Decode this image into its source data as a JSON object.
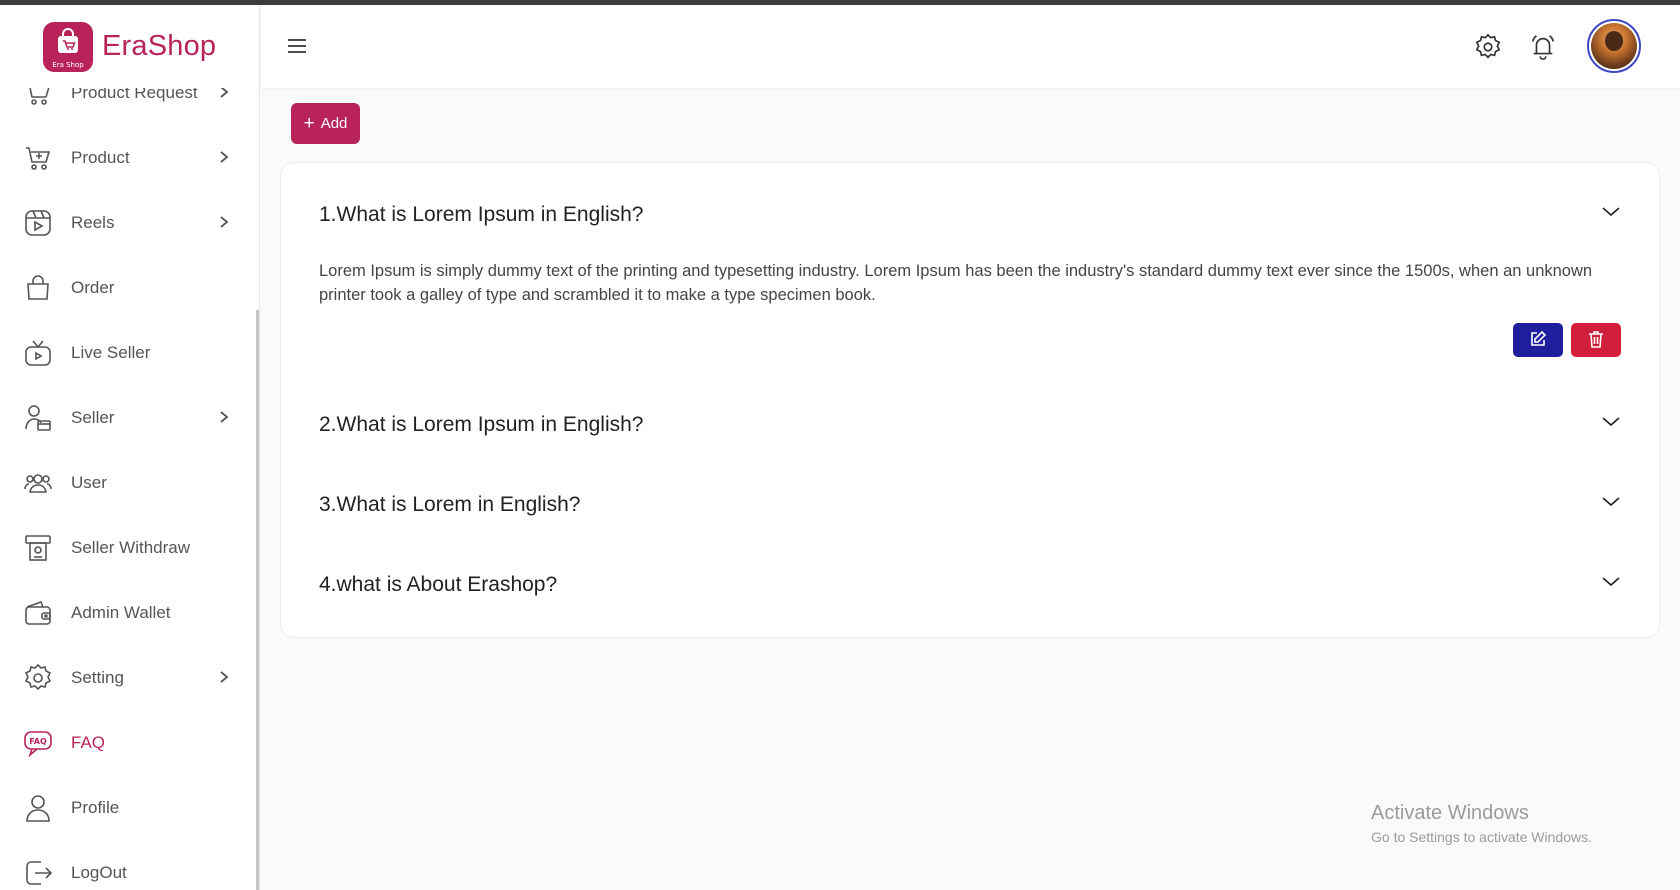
{
  "brand": {
    "name": "EraShop",
    "logo_text": "Era Shop",
    "accent_color": "#b8235a"
  },
  "sidebar": {
    "items": [
      {
        "label": "Product Request",
        "icon": "cart-icon",
        "chevron": true,
        "active": false
      },
      {
        "label": "Product",
        "icon": "cart-add-icon",
        "chevron": true,
        "active": false
      },
      {
        "label": "Reels",
        "icon": "reels-icon",
        "chevron": true,
        "active": false
      },
      {
        "label": "Order",
        "icon": "bag-icon",
        "chevron": false,
        "active": false
      },
      {
        "label": "Live Seller",
        "icon": "live-tv-icon",
        "chevron": false,
        "active": false
      },
      {
        "label": "Seller",
        "icon": "seller-icon",
        "chevron": true,
        "active": false
      },
      {
        "label": "User",
        "icon": "users-icon",
        "chevron": false,
        "active": false
      },
      {
        "label": "Seller Withdraw",
        "icon": "withdraw-icon",
        "chevron": false,
        "active": false
      },
      {
        "label": "Admin Wallet",
        "icon": "wallet-icon",
        "chevron": false,
        "active": false
      },
      {
        "label": "Setting",
        "icon": "gear-icon",
        "chevron": true,
        "active": false
      },
      {
        "label": "FAQ",
        "icon": "faq-icon",
        "chevron": false,
        "active": true
      },
      {
        "label": "Profile",
        "icon": "profile-icon",
        "chevron": false,
        "active": false
      },
      {
        "label": "LogOut",
        "icon": "logout-icon",
        "chevron": false,
        "active": false
      }
    ]
  },
  "header": {
    "menu_icon": "hamburger-icon",
    "settings_icon": "gear-icon",
    "notification_icon": "bell-icon",
    "avatar_icon": "avatar"
  },
  "main": {
    "add_label": "Add",
    "faqs": [
      {
        "question": "1.What is Lorem Ipsum in English?",
        "answer": "Lorem Ipsum is simply dummy text of the printing and typesetting industry. Lorem Ipsum has been the industry's standard dummy text ever since the 1500s, when an unknown printer took a galley of type and scrambled it to make a type specimen book.",
        "expanded": true
      },
      {
        "question": "2.What is Lorem Ipsum in English?",
        "expanded": false
      },
      {
        "question": "3.What is Lorem in English?",
        "expanded": false
      },
      {
        "question": "4.what is About Erashop?",
        "expanded": false
      }
    ],
    "edit_color": "#1f1f9e",
    "delete_color": "#cf1f3a"
  },
  "watermark": {
    "title": "Activate Windows",
    "subtitle": "Go to Settings to activate Windows."
  }
}
